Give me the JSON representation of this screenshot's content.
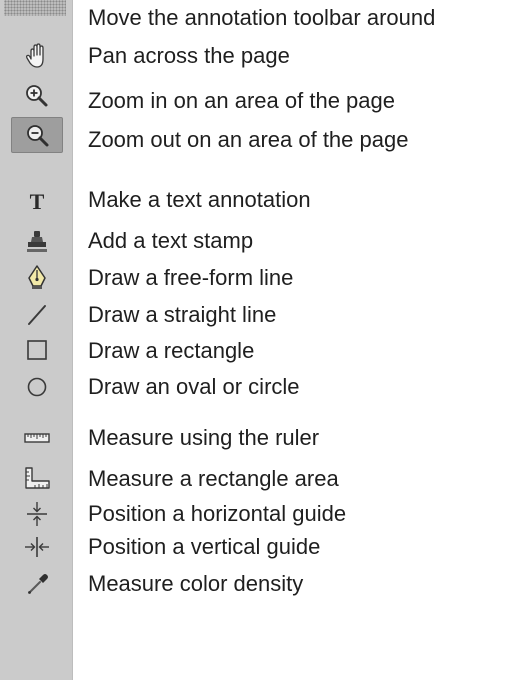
{
  "toolbar": {
    "tools": [
      {
        "icon": "grip-icon",
        "description": "Move the annotation toolbar around"
      },
      {
        "icon": "hand-icon",
        "description": "Pan across the page"
      },
      {
        "icon": "zoom-in-icon",
        "description": "Zoom in on an area of the page"
      },
      {
        "icon": "zoom-out-icon",
        "description": "Zoom out on an area of the page",
        "selected": true
      },
      {
        "icon": "text-icon",
        "description": "Make a text annotation"
      },
      {
        "icon": "stamp-icon",
        "description": "Add a text stamp"
      },
      {
        "icon": "pen-icon",
        "description": "Draw a free-form line"
      },
      {
        "icon": "line-icon",
        "description": "Draw a straight line"
      },
      {
        "icon": "rectangle-icon",
        "description": "Draw a rectangle"
      },
      {
        "icon": "oval-icon",
        "description": "Draw an oval or circle"
      },
      {
        "icon": "ruler-icon",
        "description": "Measure using the ruler"
      },
      {
        "icon": "area-ruler-icon",
        "description": "Measure a rectangle area"
      },
      {
        "icon": "horizontal-guide-icon",
        "description": "Position a horizontal guide"
      },
      {
        "icon": "vertical-guide-icon",
        "description": "Position a vertical guide"
      },
      {
        "icon": "eyedropper-icon",
        "description": "Measure color density"
      }
    ]
  },
  "colors": {
    "toolbar_bg": "#cbcbcb",
    "selected_bg": "#9e9e9e",
    "text": "#1f1f1f"
  }
}
